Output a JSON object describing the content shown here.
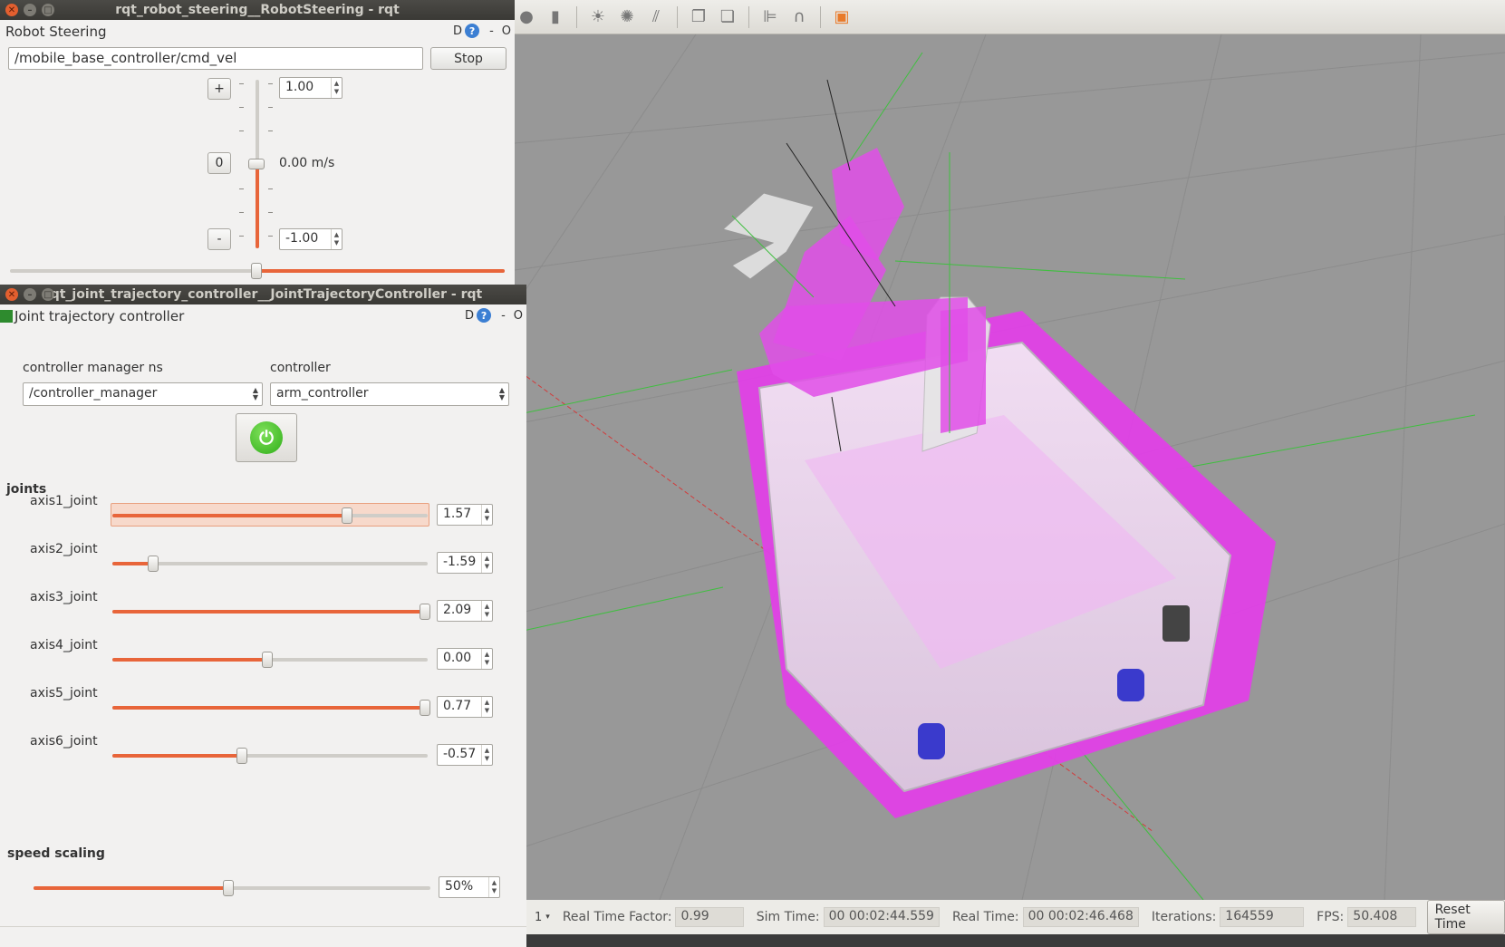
{
  "robot_steering": {
    "window_title": "rqt_robot_steering__RobotSteering - rqt",
    "plugin_title": "Robot Steering",
    "topic": "/mobile_base_controller/cmd_vel",
    "stop_label": "Stop",
    "plus_label": "+",
    "zero_label": "0",
    "minus_label": "-",
    "max_value": "1.00",
    "min_value": "-1.00",
    "speed_text": "0.00 m/s",
    "plugin_controls": {
      "d": "D",
      "help": "?",
      "minimize": "-",
      "close": "O"
    }
  },
  "jtc": {
    "window_title": "rqt_joint_trajectory_controller__JointTrajectoryController - rqt",
    "plugin_title": "Joint trajectory controller",
    "plugin_controls": {
      "d": "D",
      "help": "?",
      "minimize": "-",
      "close": "O"
    },
    "ns_label": "controller manager ns",
    "controller_label": "controller",
    "ns_value": "/controller_manager",
    "controller_value": "arm_controller",
    "power_icon": "power-icon",
    "joints_title": "joints",
    "joints": [
      {
        "name": "axis1_joint",
        "value": "1.57",
        "fraction": 0.745
      },
      {
        "name": "axis2_joint",
        "value": "-1.59",
        "fraction": 0.13
      },
      {
        "name": "axis3_joint",
        "value": "2.09",
        "fraction": 0.99
      },
      {
        "name": "axis4_joint",
        "value": "0.00",
        "fraction": 0.49
      },
      {
        "name": "axis5_joint",
        "value": "0.77",
        "fraction": 0.99
      },
      {
        "name": "axis6_joint",
        "value": "-0.57",
        "fraction": 0.41
      }
    ],
    "speed_title": "speed scaling",
    "speed_value": "50%",
    "speed_fraction": 0.49
  },
  "gazebo": {
    "status": {
      "step": "1",
      "rtf_label": "Real Time Factor:",
      "rtf_value": "0.99",
      "sim_label": "Sim Time:",
      "sim_value": "00 00:02:44.559",
      "real_label": "Real Time:",
      "real_value": "00 00:02:46.468",
      "iter_label": "Iterations:",
      "iter_value": "164559",
      "fps_label": "FPS:",
      "fps_value": "50.408",
      "reset_label": "Reset Time"
    },
    "toolbar_icons": [
      "sphere-icon",
      "cylinder-icon",
      "sun-icon",
      "spot-light-icon",
      "directional-light-icon",
      "copy-icon",
      "paste-icon",
      "align-icon",
      "snap-icon",
      "view-angle-icon"
    ],
    "colors": {
      "viewport": "#989898",
      "robot_highlight": "#e040e6",
      "grid": "#8a8a8a"
    }
  },
  "colors": {
    "accent": "#e8653a",
    "titlebar": "#3d3c38",
    "panel": "#f2f1f0",
    "close": "#e35f2f"
  }
}
